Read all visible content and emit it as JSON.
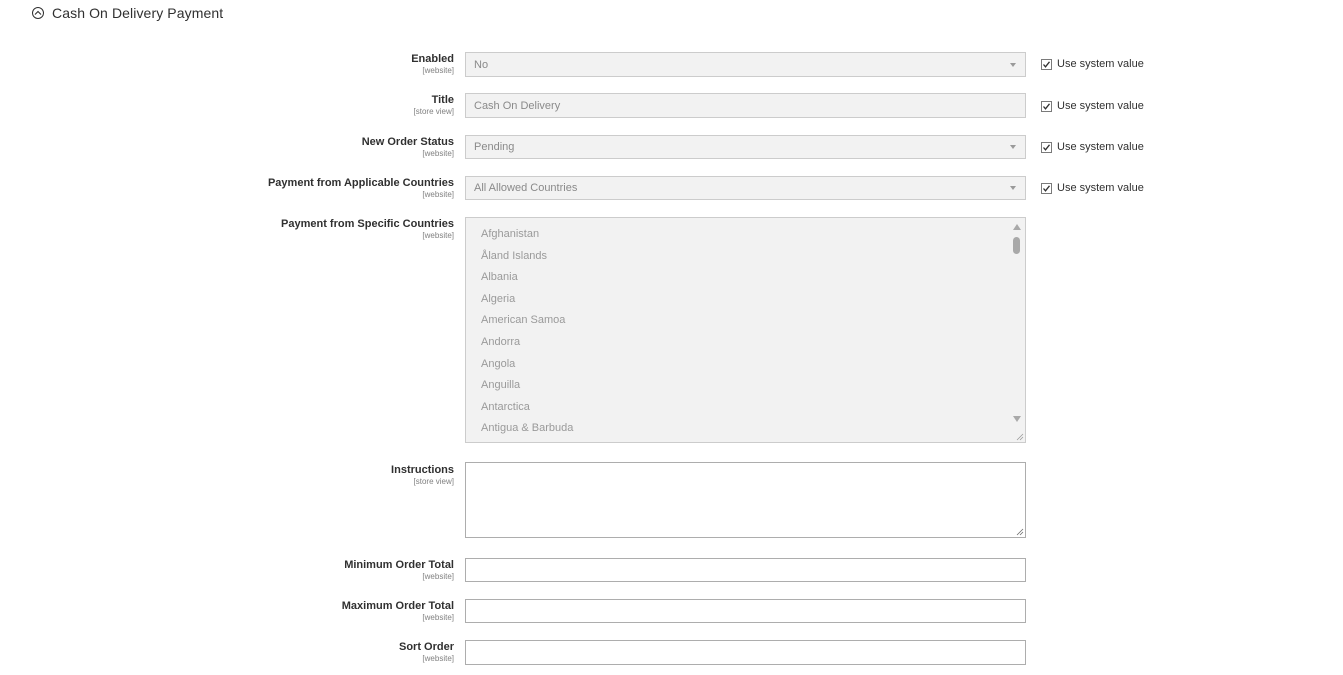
{
  "section": {
    "title": "Cash On Delivery Payment",
    "icon": "chevron-up-circle-icon"
  },
  "fields": {
    "enabled": {
      "label": "Enabled",
      "scope": "[website]",
      "value": "No",
      "use_system": "Use system value",
      "use_system_checked": true
    },
    "title": {
      "label": "Title",
      "scope": "[store view]",
      "value": "Cash On Delivery",
      "use_system": "Use system value",
      "use_system_checked": true
    },
    "new_order_status": {
      "label": "New Order Status",
      "scope": "[website]",
      "value": "Pending",
      "use_system": "Use system value",
      "use_system_checked": true
    },
    "applicable_countries": {
      "label": "Payment from Applicable Countries",
      "scope": "[website]",
      "value": "All Allowed Countries",
      "use_system": "Use system value",
      "use_system_checked": true
    },
    "specific_countries": {
      "label": "Payment from Specific Countries",
      "scope": "[website]",
      "options": [
        "Afghanistan",
        "Åland Islands",
        "Albania",
        "Algeria",
        "American Samoa",
        "Andorra",
        "Angola",
        "Anguilla",
        "Antarctica",
        "Antigua & Barbuda"
      ]
    },
    "instructions": {
      "label": "Instructions",
      "scope": "[store view]",
      "value": ""
    },
    "min_order_total": {
      "label": "Minimum Order Total",
      "scope": "[website]",
      "value": ""
    },
    "max_order_total": {
      "label": "Maximum Order Total",
      "scope": "[website]",
      "value": ""
    },
    "sort_order": {
      "label": "Sort Order",
      "scope": "[website]",
      "value": ""
    }
  },
  "colors": {
    "disabled_bg": "#f2f2f2",
    "text": "#303030",
    "muted": "#808080"
  }
}
